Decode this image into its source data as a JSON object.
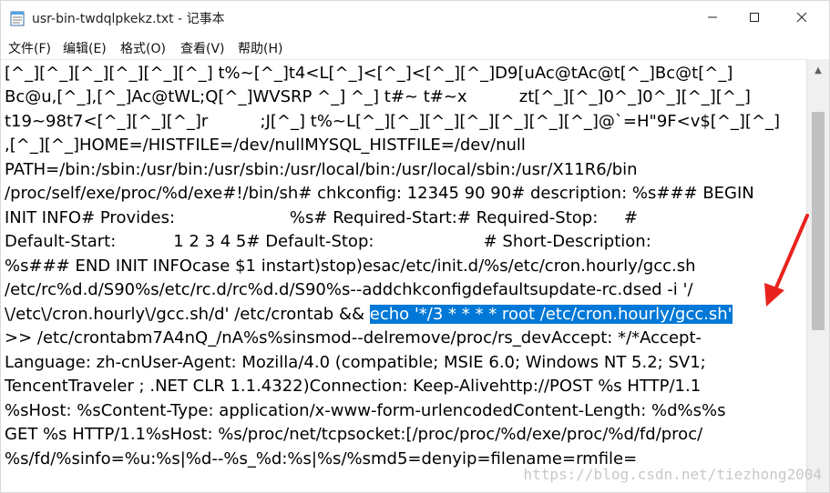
{
  "window": {
    "title": "usr-bin-twdqlpkekz.txt - 记事本",
    "icons": [
      "notepad-icon",
      "minimize-icon",
      "maximize-icon",
      "close-icon"
    ]
  },
  "menu": [
    {
      "label": "文件(F)"
    },
    {
      "label": "编辑(E)"
    },
    {
      "label": "格式(O)"
    },
    {
      "label": "查看(V)"
    },
    {
      "label": "帮助(H)"
    }
  ],
  "editor": {
    "lines": [
      "[^_][^_][^_][^_][^_][^_] t%~[^_]t4<L[^_]<[^_]<[^_][^_]D9[uAc@tAc@t[^_]Bc@t[^_]",
      "Bc@u,[^_],[^_]Ac@tWL;Q[^_]WVSRP ^_] ^_] t#~ t#~x          zt[^_][^_]0^_]0^_][^_][^_]",
      "t19~98t7<[^_][^_][^_]r          ;J[^_] t%~L[^_][^_][^_][^_][^_][^_][^_]@`=H\"9F<v$[^_][^_]",
      ",[^_][^_]HOME=/HISTFILE=/dev/nullMYSQL_HISTFILE=/dev/null",
      "PATH=/bin:/sbin:/usr/bin:/usr/sbin:/usr/local/bin:/usr/local/sbin:/usr/X11R6/bin",
      "/proc/self/exe/proc/%d/exe#!/bin/sh# chkconfig: 12345 90 90# description: %s### BEGIN",
      "INIT INFO# Provides:                      %s# Required-Start:# Required-Stop:     #",
      "Default-Start:           1 2 3 4 5# Default-Stop:                     # Short-Description:",
      "%s### END INIT INFOcase $1 instart)stop)esac/etc/init.d/%s/etc/cron.hourly/gcc.sh",
      "/etc/rc%d.d/S90%s/etc/rc.d/rc%d.d/S90%s--addchkconfigdefaultsupdate-rc.dsed -i '/",
      "\\/etc\\/cron.hourly\\/gcc.sh/d' /etc/crontab && ",
      ">> /etc/crontabm7A4nQ_/nA%s%sinsmod--delremove/proc/rs_devAccept: */*Accept-",
      "Language: zh-cnUser-Agent: Mozilla/4.0 (compatible; MSIE 6.0; Windows NT 5.2; SV1;",
      "TencentTraveler ; .NET CLR 1.1.4322)Connection: Keep-Alivehttp://POST %s HTTP/1.1",
      "%sHost: %sContent-Type: application/x-www-form-urlencodedContent-Length: %d%s%s",
      "GET %s HTTP/1.1%sHost: %s/proc/net/tcpsocket:[/proc/proc/%d/exe/proc/%d/fd/proc/",
      "%s/fd/%sinfo=%u:%s|%d--%s_%d:%s|%s/%smd5=denyip=filename=rmfile="
    ],
    "selected_text": "echo '*/3 * * * * root /etc/cron.hourly/gcc.sh'"
  },
  "watermark": "https://blog.csdn.net/tiezhong2004",
  "colors": {
    "selection": "#0078d7",
    "arrow": "#e8231f"
  }
}
